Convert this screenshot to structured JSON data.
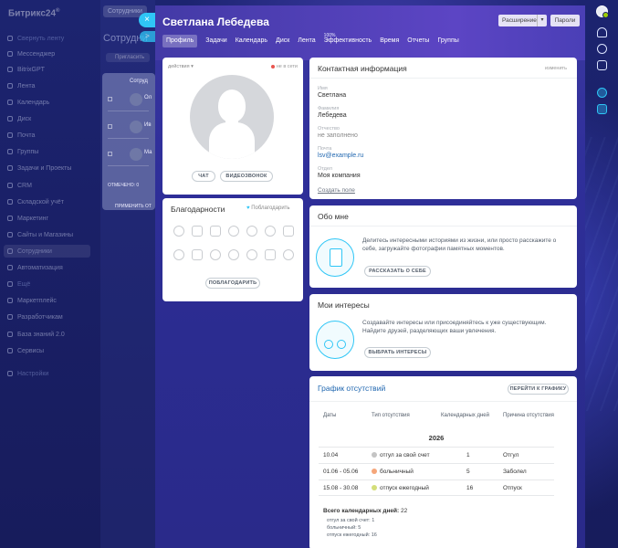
{
  "app": {
    "logo": "Битрикс24",
    "logo_sup": "®"
  },
  "sidebar": {
    "collapse_label": "Свернуть ленту",
    "items": [
      {
        "label": "Мессенджер"
      },
      {
        "label": "BitrixGPT"
      },
      {
        "label": "Лента"
      },
      {
        "label": "Календарь"
      },
      {
        "label": "Диск"
      },
      {
        "label": "Почта"
      },
      {
        "label": "Группы"
      },
      {
        "label": "Задачи и Проекты"
      },
      {
        "label": "CRM"
      },
      {
        "label": "Складской учёт"
      },
      {
        "label": "Маркетинг"
      },
      {
        "label": "Сайты и Магазины"
      },
      {
        "label": "Сотрудники"
      },
      {
        "label": "Автоматизация"
      },
      {
        "label": "Ещё"
      },
      {
        "label": "Маркетплейс"
      },
      {
        "label": "Разработчикам"
      },
      {
        "label": "База знаний 2.0"
      },
      {
        "label": "Сервисы"
      },
      {
        "label": "Настройки"
      }
    ]
  },
  "background_page": {
    "tab": "Сотрудники",
    "title": "Сотрудни",
    "invite": "Пригласить",
    "list_header": "Сотруд",
    "rows": [
      {
        "name": "Ол"
      },
      {
        "name": "Ив"
      },
      {
        "name": "Ма"
      }
    ],
    "footer": "ОТМЕЧЕНО: 0",
    "footer2": "ПРИМЕНИТЬ ОТ"
  },
  "slider": {
    "close_icon": "×",
    "title": "Светлана Лебедева",
    "extension_label": "Расширение",
    "passwords_label": "Пароли",
    "tabs": [
      {
        "label": "Профиль",
        "active": true
      },
      {
        "label": "Задачи"
      },
      {
        "label": "Календарь"
      },
      {
        "label": "Диск"
      },
      {
        "label": "Лента"
      },
      {
        "label": "Эффективность",
        "pct": "100%"
      },
      {
        "label": "Время"
      },
      {
        "label": "Отчеты"
      },
      {
        "label": "Группы"
      }
    ]
  },
  "profile_card": {
    "actions": "действия",
    "status": "не в сети",
    "chat": "ЧАТ",
    "video": "ВИДЕОЗВОНОК"
  },
  "thanks": {
    "title": "Благодарности",
    "thank_link": "Поблагодарить",
    "thank_button": "ПОБЛАГОДАРИТЬ"
  },
  "contact": {
    "title": "Контактная информация",
    "edit": "изменить",
    "fields": [
      {
        "label": "Имя",
        "value": "Светлана"
      },
      {
        "label": "Фамилия",
        "value": "Лебедева"
      },
      {
        "label": "Отчество",
        "value": "не заполнено"
      },
      {
        "label": "Почта",
        "value": "lsv@example.ru"
      },
      {
        "label": "Отдел",
        "value": "Моя компания"
      }
    ],
    "create_field": "Создать поле"
  },
  "about": {
    "title": "Обо мне",
    "text": "Делитесь интересными историями из жизни, или просто расскажите о себе, загружайте фотографии памятных моментов.",
    "button": "РАССКАЗАТЬ О СЕБЕ"
  },
  "interests": {
    "title": "Мои интересы",
    "text": "Создавайте интересы или присоединяйтесь к уже существующим. Найдите друзей, разделяющих ваши увлечения.",
    "button": "ВЫБРАТЬ ИНТЕРЕСЫ"
  },
  "absence": {
    "title": "График отсутствий",
    "goto": "ПЕРЕЙТИ К ГРАФИКУ",
    "headers": [
      "Даты",
      "Тип отсутствия",
      "Календарных дней",
      "Причина отсутствия"
    ],
    "year": "2026",
    "rows": [
      {
        "dates": "10.04",
        "type": "отгул за свой счет",
        "color": "#c4c4c4",
        "days": "1",
        "reason": "Отгул"
      },
      {
        "dates": "01.06 - 05.06",
        "type": "больничный",
        "color": "#f5a67a",
        "days": "5",
        "reason": "Заболел"
      },
      {
        "dates": "15.08 - 30.08",
        "type": "отпуск ежегодный",
        "color": "#d4de7a",
        "days": "16",
        "reason": "Отпуск"
      }
    ],
    "total_label": "Всего календарных дней:",
    "total_value": "22",
    "breakdown": [
      "отгул за свой счет: 1",
      "больничный: 5",
      "отпуск ежегодный: 16"
    ]
  },
  "colors": {
    "accent": "#2fc6f6",
    "link": "#2067b0",
    "offline": "#e8554e"
  }
}
